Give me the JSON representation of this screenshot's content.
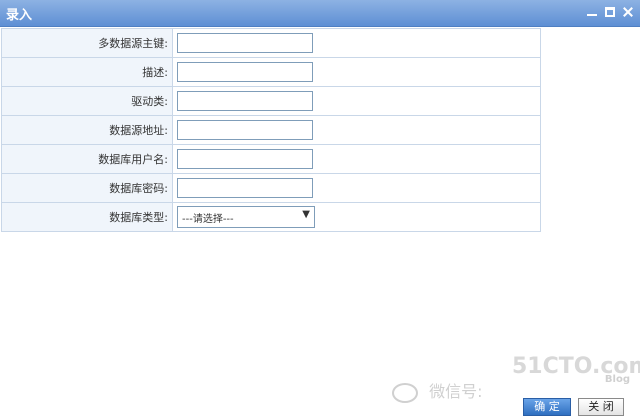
{
  "window": {
    "title": "录入"
  },
  "form": {
    "fields": [
      {
        "label": "多数据源主键:",
        "value": ""
      },
      {
        "label": "描述:",
        "value": ""
      },
      {
        "label": "驱动类:",
        "value": ""
      },
      {
        "label": "数据源地址:",
        "value": ""
      },
      {
        "label": "数据库用户名:",
        "value": ""
      },
      {
        "label": "数据库密码:",
        "value": ""
      }
    ],
    "type_field": {
      "label": "数据库类型:",
      "selected": "---请选择---"
    }
  },
  "buttons": {
    "ok_label": "确 定",
    "close_label": "关 闭"
  },
  "watermark": {
    "logo": "51CTO.com",
    "logo_sub": "Blog",
    "wechat": "微信号:"
  }
}
